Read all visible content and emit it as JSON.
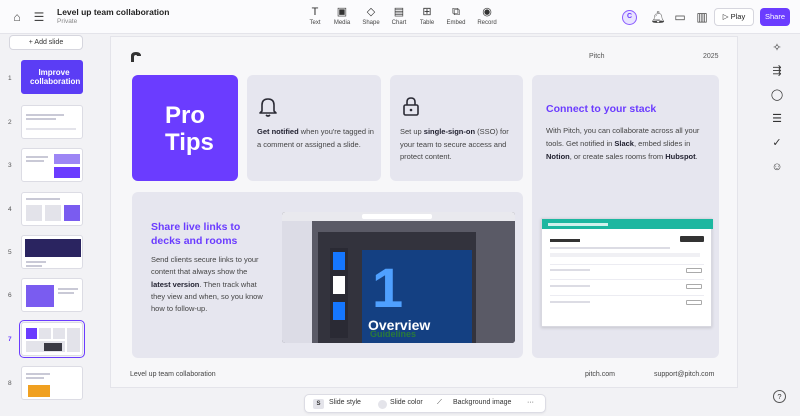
{
  "header": {
    "home_icon": "home-icon",
    "menu_icon": "menu-icon",
    "title": "Level up team collaboration",
    "visibility": "Private",
    "tools": [
      "Text",
      "Media",
      "Shape",
      "Chart",
      "Table",
      "Embed",
      "Record"
    ],
    "avatar_letter": "C",
    "play_label": "Play",
    "share_label": "Share",
    "accent_color": "#6b3cff"
  },
  "sidebar": {
    "add_slide_label": "+ Add slide",
    "slide_numbers": [
      "1",
      "2",
      "3",
      "4",
      "5",
      "6",
      "7",
      "8"
    ],
    "thumb1_title": "Improve collaboration",
    "selected_slide": "7"
  },
  "slide": {
    "brand": "Pitch",
    "year": "2025",
    "protips_line1": "Pro",
    "protips_line2": "Tips",
    "tip1_bold": "Get notified",
    "tip1_rest": " when you're tagged in a comment or assigned a slide.",
    "tip2_pre": "Set up ",
    "tip2_bold": "single-sign-on",
    "tip2_rest": " (SSO) for your team to secure access and protect content.",
    "connect_title": "Connect to your stack",
    "connect_p1": "With Pitch, you can collaborate across all your tools. Get notified in ",
    "connect_slack": "Slack",
    "connect_p2": ", embed slides in ",
    "connect_notion": "Notion",
    "connect_p3": ", or create sales rooms from ",
    "connect_hubspot": "Hubspot",
    "connect_p4": ".",
    "share_title": "Share live links to decks and rooms",
    "share_p1": "Send clients secure links to your content that always show the ",
    "share_bold": "latest version",
    "share_p2": ". Then track what they view and when, so you know how to follow-up.",
    "mock_number": "1",
    "mock_overview": "Overview",
    "mock_guidelines": "Guidelines",
    "footer_title": "Level up team collaboration",
    "footer_site": "pitch.com",
    "footer_email": "support@pitch.com"
  },
  "bottom_toolbar": {
    "style_badge": "S",
    "slide_style": "Slide style",
    "slide_color": "Slide color",
    "background_image": "Background image",
    "more": "···"
  },
  "help_label": "?"
}
